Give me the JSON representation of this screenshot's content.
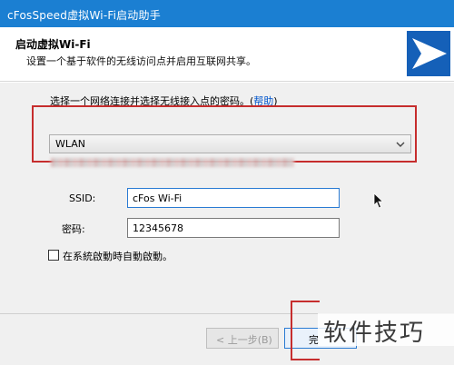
{
  "window": {
    "title": "cFosSpeed虚拟Wi-Fi启动助手"
  },
  "header": {
    "title": "启动虚拟Wi-Fi",
    "subtitle": "设置一个基于软件的无线访问点并启用互联网共享。",
    "logo_icon": "cfos-arrow-logo"
  },
  "main": {
    "instruction": "选择一个网络连接并选择无线接入点的密码。",
    "help_open": "(",
    "help_link": "帮助",
    "help_close": ")",
    "network_select": {
      "selected": "WLAN"
    },
    "ssid": {
      "label": "SSID:",
      "value": "cFos Wi-Fi"
    },
    "password": {
      "label": "密码:",
      "value": "12345678"
    },
    "autostart": {
      "label": "在系統啟動時自動啟動。",
      "checked": false
    }
  },
  "footer": {
    "prev_label": "< 上一步(B)",
    "next_label": "完"
  },
  "watermark": {
    "text": "软件技巧"
  },
  "colors": {
    "titlebar": "#1b7fd2",
    "highlight_frame": "#c62d2d",
    "link": "#0055cc"
  }
}
